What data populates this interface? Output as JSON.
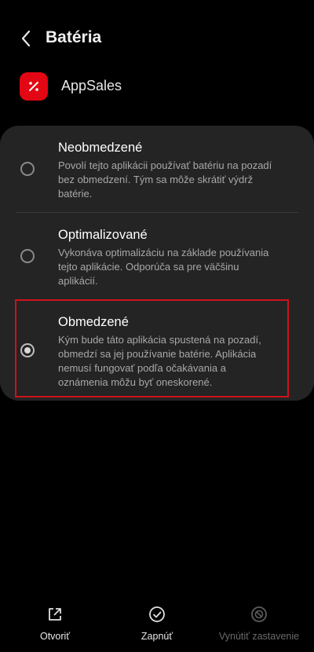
{
  "header": {
    "title": "Batéria",
    "back_icon": "chevron-left-icon"
  },
  "app": {
    "name": "AppSales",
    "icon": "appsales-logo-icon",
    "icon_color": "#e30613"
  },
  "options": [
    {
      "title": "Neobmedzené",
      "desc_lines": [
        "Povolí tejto aplikácii používať batériu na pozadí",
        "bez obmedzení. Tým sa môže skrátiť výdrž",
        "batérie."
      ],
      "selected": false
    },
    {
      "title": "Optimalizované",
      "desc_lines": [
        "Vykonáva optimalizáciu na základe používania",
        "tejto aplikácie. Odporúča sa pre väčšinu",
        "aplikácií."
      ],
      "selected": false
    },
    {
      "title": "Obmedzené",
      "desc_lines": [
        "Kým bude táto aplikácia spustená na pozadí,",
        "obmedzí sa jej používanie batérie. Aplikácia",
        "nemusí fungovať podľa očakávania a",
        "oznámenia môžu byť oneskorené."
      ],
      "selected": true
    }
  ],
  "highlight_color": "#d0121b",
  "bottom_bar": {
    "open_label": "Otvoriť",
    "open_icon": "open-external-icon",
    "enable_label": "Zapnúť",
    "enable_icon": "check-circle-icon",
    "force_stop_label": "Vynútiť zastavenie",
    "force_stop_icon": "block-icon",
    "force_stop_enabled": false
  }
}
